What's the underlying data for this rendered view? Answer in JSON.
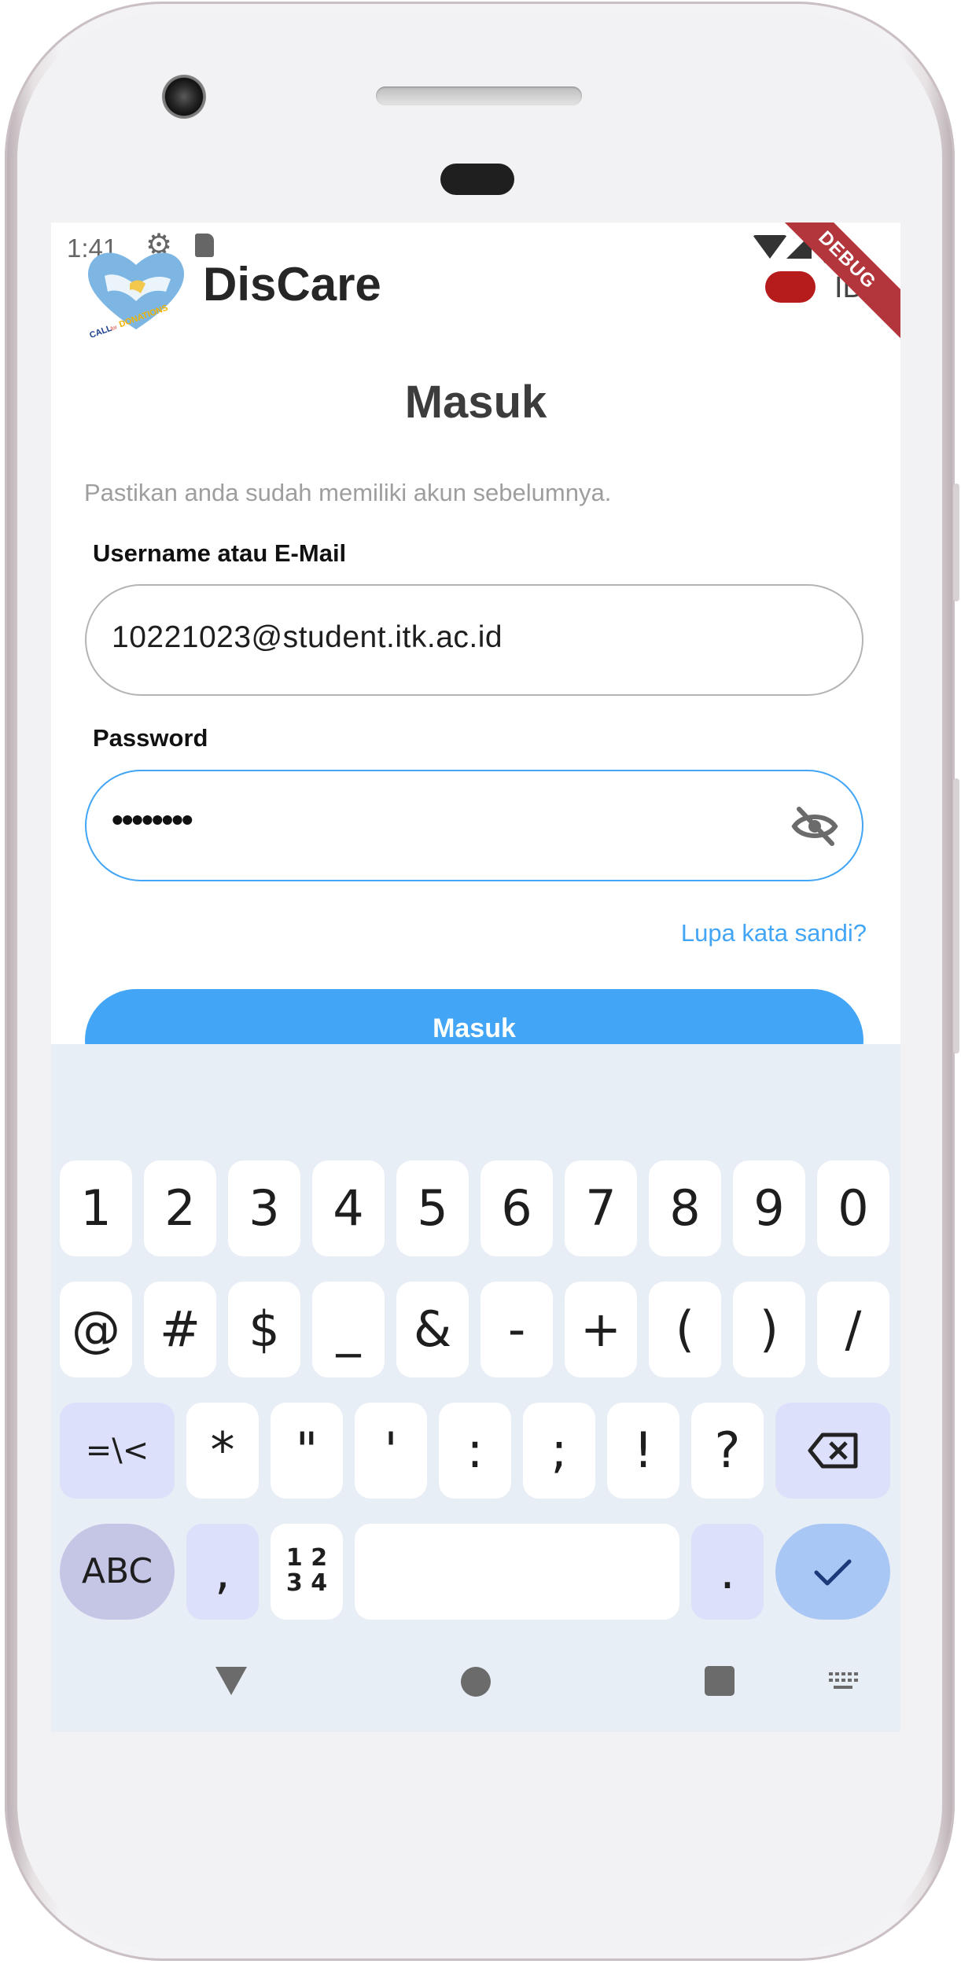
{
  "status_bar": {
    "time": "1:41"
  },
  "debug_banner": "DEBUG",
  "header": {
    "app_name": "DisCare",
    "language": "ID"
  },
  "login": {
    "title": "Masuk",
    "subtitle": "Pastikan anda sudah memiliki akun sebelumnya.",
    "username_label": "Username atau E-Mail",
    "username_value": "10221023@student.itk.ac.id",
    "password_label": "Password",
    "password_masked": "••••••••",
    "forgot_link": "Lupa kata sandi?",
    "submit_label": "Masuk"
  },
  "keyboard": {
    "row1": [
      "1",
      "2",
      "3",
      "4",
      "5",
      "6",
      "7",
      "8",
      "9",
      "0"
    ],
    "row2": [
      "@",
      "#",
      "$",
      "_",
      "&",
      "-",
      "+",
      "(",
      ")",
      "/"
    ],
    "row3": [
      "=\\<",
      "*",
      "\"",
      "'",
      ":",
      ";",
      "!",
      "?"
    ],
    "row4": {
      "abc": "ABC",
      "comma": ",",
      "numpad": "1 2\n3 4",
      "period": "."
    }
  },
  "colors": {
    "accent": "#42a5f5",
    "toggle": "#b71c1c",
    "debug": "#b3363c"
  }
}
